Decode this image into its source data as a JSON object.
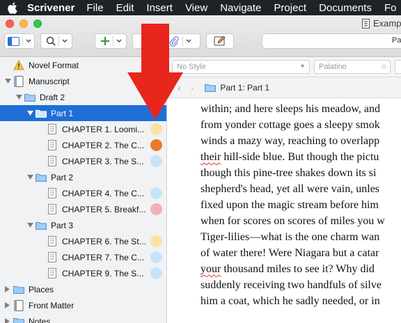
{
  "menubar": {
    "app": "Scrivener",
    "items": [
      "File",
      "Edit",
      "Insert",
      "View",
      "Navigate",
      "Project",
      "Documents",
      "Fo"
    ]
  },
  "window": {
    "title": "Examp",
    "segment_label": "Par"
  },
  "format_bar": {
    "style": "No Style",
    "font": "Palatino"
  },
  "nav": {
    "breadcrumb": "Part 1: Part 1"
  },
  "binder": {
    "novel_format": "Novel Format",
    "manuscript": "Manuscript",
    "draft": "Draft 2",
    "part1": "Part 1",
    "part1_items": [
      "CHAPTER 1. Loomi...",
      "CHAPTER 2. The C...",
      "CHAPTER 3. The S..."
    ],
    "part2": "Part 2",
    "part2_items": [
      "CHAPTER 4. The C...",
      "CHAPTER 5. Breakf..."
    ],
    "part3": "Part 3",
    "part3_items": [
      "CHAPTER 6. The St...",
      "CHAPTER 7. The C...",
      "CHAPTER 9. The S..."
    ],
    "places": "Places",
    "front_matter": "Front Matter",
    "notes": "Notes"
  },
  "label_colors": {
    "ch1": "#fbe2a6",
    "ch2": "#ea7b2a",
    "ch3": "#c7e4fb",
    "ch4": "#c7e4fb",
    "ch5": "#f1b1bb",
    "ch6": "#fbe2a6",
    "ch7": "#c7e4fb",
    "ch9": "#c7e4fb"
  },
  "editor": {
    "lines": [
      "within; and here sleeps his meadow, and",
      "from yonder cottage goes a sleepy smok",
      "winds a mazy way, reaching to overlapp",
      " hill-side blue. But though the pictu",
      "though this pine-tree shakes down its si",
      "shepherd's head, yet all were vain, unles",
      "fixed upon the magic stream before him",
      "when for scores on scores of miles you w",
      "Tiger-lilies—what is the one charm wan",
      "of water there! Were Niagara but a catar",
      " thousand miles to see it? Why did",
      "suddenly receiving two handfuls of silve",
      "him a coat, which he sadly needed, or in"
    ],
    "spell_words": {
      "line4": "their",
      "line11": "your"
    }
  },
  "colors": {
    "accent": "#1f6ed6",
    "arrow": "#e8261c"
  }
}
